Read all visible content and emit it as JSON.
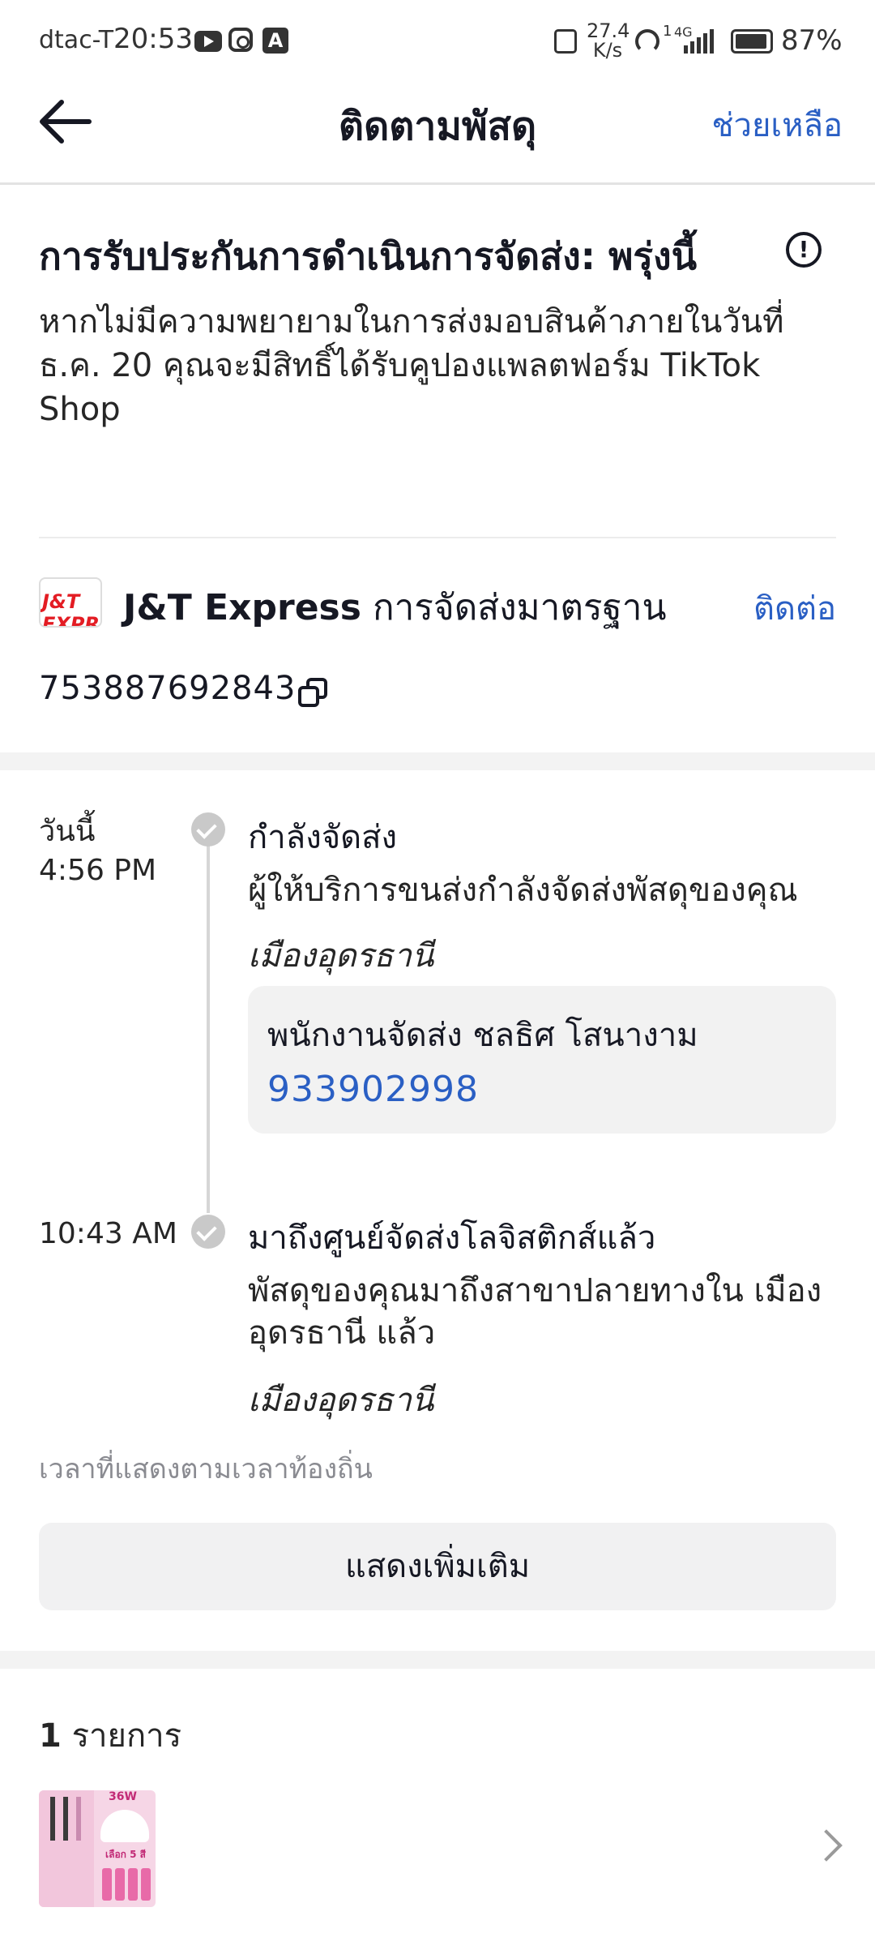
{
  "status_bar": {
    "carrier": "dtac-T",
    "time": "20:53",
    "net_speed_value": "27.4",
    "net_speed_unit": "K/s",
    "signal_sup": "1",
    "network": "4G",
    "battery": "87%"
  },
  "header": {
    "title": "ติดตามพัสดุ",
    "help_label": "ช่วยเหลือ",
    "back_icon": "arrow-left-icon"
  },
  "guarantee": {
    "title": "การรับประกันการดำเนินการจัดส่ง: พรุ่งนี้",
    "info_icon": "!",
    "description": "หากไม่มีความพยายามในการส่งมอบสินค้าภายในวันที่ ธ.ค. 20 คุณจะมีสิทธิ์ได้รับคูปองแพลตฟอร์ม TikTok Shop"
  },
  "carrier": {
    "logo_text": "J&T EXPRE",
    "name": "J&T Express",
    "service": "การจัดส่งมาตรฐาน",
    "contact_label": "ติดต่อ",
    "tracking_number": "753887692843"
  },
  "timeline": [
    {
      "day": "วันนี้",
      "time": "4:56 PM",
      "status": "กำลังจัดส่ง",
      "description": "ผู้ให้บริการขนส่งกำลังจัดส่งพัสดุของคุณ",
      "location": "เมืองอุดรธานี",
      "courier_label": "พนักงานจัดส่ง  ชลธิศ โสนางาม",
      "courier_phone": "933902998"
    },
    {
      "time": "10:43 AM",
      "status": "มาถึงศูนย์จัดส่งโลจิสติกส์แล้ว",
      "description": "พัสดุของคุณมาถึงสาขาปลายทางใน เมืองอุดรธานี แล้ว",
      "location": "เมืองอุดรธานี"
    }
  ],
  "timezone_note": "เวลาที่แสดงตามเวลาท้องถิ่น",
  "show_more_label": "แสดงเพิ่มเติม",
  "items": {
    "count": "1",
    "label": "รายการ",
    "thumb_badge": "36W",
    "thumb_caption": "เลือก 5 สี"
  },
  "colors": {
    "link_blue": "#2a5fc4",
    "logo_red": "#e31c23",
    "thumb_pink": "#f6d6e6"
  }
}
